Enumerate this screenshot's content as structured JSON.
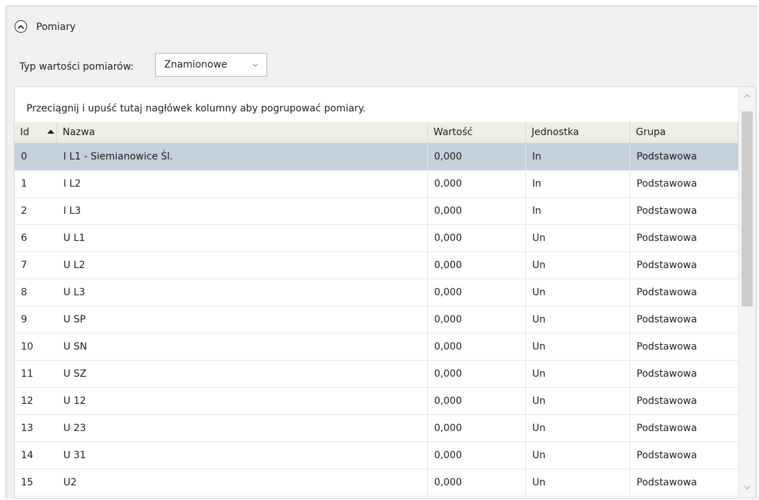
{
  "section": {
    "title": "Pomiary"
  },
  "value_type": {
    "label": "Typ wartości pomiarów:",
    "selected": "Znamionowe"
  },
  "grid": {
    "group_hint": "Przeciągnij i upuść tutaj nagłówek kolumny aby pogrupować pomiary.",
    "columns": {
      "id": "Id",
      "name": "Nazwa",
      "value": "Wartość",
      "unit": "Jednostka",
      "group": "Grupa"
    },
    "sort_column": "Id",
    "sort_direction": "ascending",
    "selected_row_id": "0",
    "rows": [
      {
        "id": "0",
        "name": "I L1 - Siemianowice Śl.",
        "value": "0,000",
        "unit": "In",
        "group": "Podstawowa"
      },
      {
        "id": "1",
        "name": "I L2",
        "value": "0,000",
        "unit": "In",
        "group": "Podstawowa"
      },
      {
        "id": "2",
        "name": "I L3",
        "value": "0,000",
        "unit": "In",
        "group": "Podstawowa"
      },
      {
        "id": "6",
        "name": "U L1",
        "value": "0,000",
        "unit": "Un",
        "group": "Podstawowa"
      },
      {
        "id": "7",
        "name": "U L2",
        "value": "0,000",
        "unit": "Un",
        "group": "Podstawowa"
      },
      {
        "id": "8",
        "name": "U L3",
        "value": "0,000",
        "unit": "Un",
        "group": "Podstawowa"
      },
      {
        "id": "9",
        "name": "U SP",
        "value": "0,000",
        "unit": "Un",
        "group": "Podstawowa"
      },
      {
        "id": "10",
        "name": "U SN",
        "value": "0,000",
        "unit": "Un",
        "group": "Podstawowa"
      },
      {
        "id": "11",
        "name": "U SZ",
        "value": "0,000",
        "unit": "Un",
        "group": "Podstawowa"
      },
      {
        "id": "12",
        "name": "U 12",
        "value": "0,000",
        "unit": "Un",
        "group": "Podstawowa"
      },
      {
        "id": "13",
        "name": "U 23",
        "value": "0,000",
        "unit": "Un",
        "group": "Podstawowa"
      },
      {
        "id": "14",
        "name": "U 31",
        "value": "0,000",
        "unit": "Un",
        "group": "Podstawowa"
      },
      {
        "id": "15",
        "name": "U2",
        "value": "0,000",
        "unit": "Un",
        "group": "Podstawowa"
      }
    ]
  },
  "colors": {
    "selected_row": "#c4d0de",
    "header_background": "#eeeee5",
    "panel_background": "#f0f0f0"
  },
  "icons": {
    "expander": "chevron-up-circle-icon",
    "dropdown": "chevron-down-icon",
    "sort": "sort-ascending-icon",
    "scroll_up": "scroll-up-arrow-icon",
    "scroll_down": "scroll-down-arrow-icon"
  }
}
